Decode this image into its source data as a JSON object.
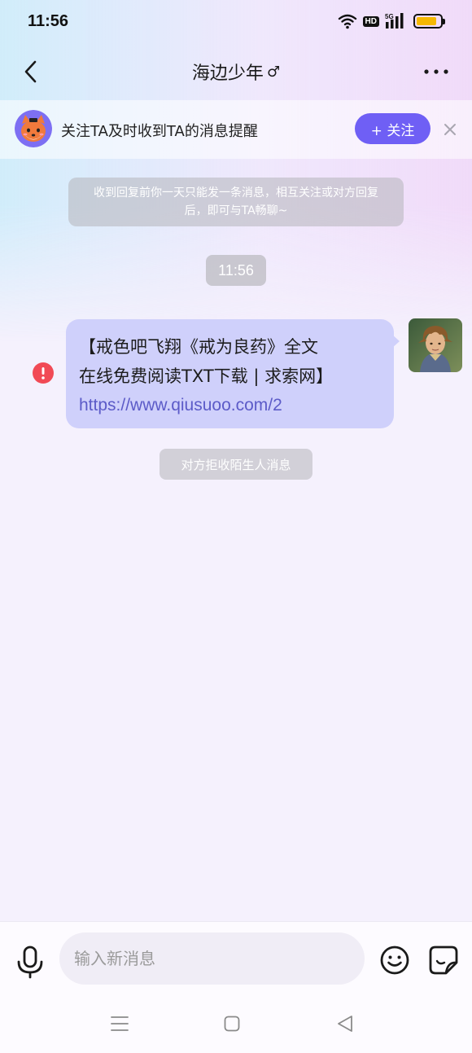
{
  "status_bar": {
    "time": "11:56",
    "hd_badge": "HD",
    "network": "5G",
    "battery_level": 0.85,
    "battery_color": "#f5b800"
  },
  "header": {
    "title": "海边少年",
    "gender_symbol": "♂",
    "back_icon": "chevron-left-icon",
    "more_icon": "more-dots-icon"
  },
  "follow_bar": {
    "prompt": "关注TA及时收到TA的消息提醒",
    "button_label": "+ 关注",
    "button_color": "#6f5ff5",
    "close_icon": "close-icon"
  },
  "messages": {
    "notice": "收到回复前你一天只能发一条消息，相互关注或对方回复后，即可与TA畅聊~",
    "timestamp": "11:56",
    "sent": {
      "line1": "【戒色吧飞翔《戒为良药》全文",
      "line2": "在线免费阅读TXT下载 | 求索网】",
      "link": "https://www.qiusuoo.com/2",
      "status_icon": "error-icon",
      "bubble_color": "#cfd0fb"
    },
    "reject_notice": "对方拒收陌生人消息"
  },
  "composer": {
    "placeholder": "输入新消息",
    "value": ""
  }
}
